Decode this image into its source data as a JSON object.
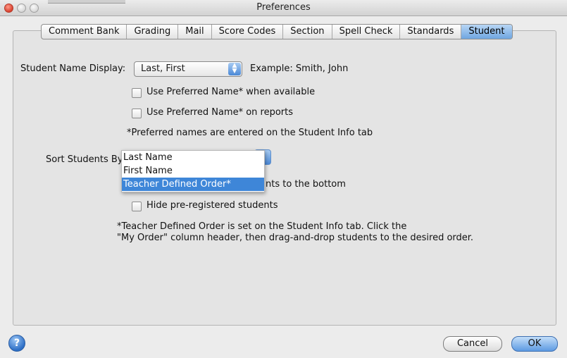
{
  "window": {
    "title": "Preferences"
  },
  "tabs": [
    {
      "label": "Comment Bank"
    },
    {
      "label": "Grading"
    },
    {
      "label": "Mail"
    },
    {
      "label": "Score Codes"
    },
    {
      "label": "Section"
    },
    {
      "label": "Spell Check"
    },
    {
      "label": "Standards"
    },
    {
      "label": "Student",
      "active": true
    }
  ],
  "name_display": {
    "label": "Student Name Display:",
    "selected": "Last, First",
    "example": "Example: Smith, John"
  },
  "checkboxes": {
    "preferred_available": "Use Preferred Name* when available",
    "preferred_reports": "Use Preferred Name* on reports",
    "drop_students": "nts to the bottom",
    "hide_preregistered": "Hide pre-registered students"
  },
  "notes": {
    "preferred": "*Preferred names are entered on the Student Info tab",
    "order_line1": "*Teacher Defined Order is set on the Student Info tab.  Click the",
    "order_line2": "\"My Order\" column header, then drag-and-drop students to the desired order."
  },
  "sort": {
    "label": "Sort Students By",
    "options": [
      {
        "label": "Last Name"
      },
      {
        "label": "First Name"
      },
      {
        "label": "Teacher Defined Order*",
        "selected": true
      }
    ]
  },
  "footer": {
    "cancel_label": "Cancel",
    "ok_label": "OK",
    "help_glyph": "?"
  },
  "colors": {
    "accent": "#3e86d8",
    "active_tab": "#6fa6e0"
  }
}
